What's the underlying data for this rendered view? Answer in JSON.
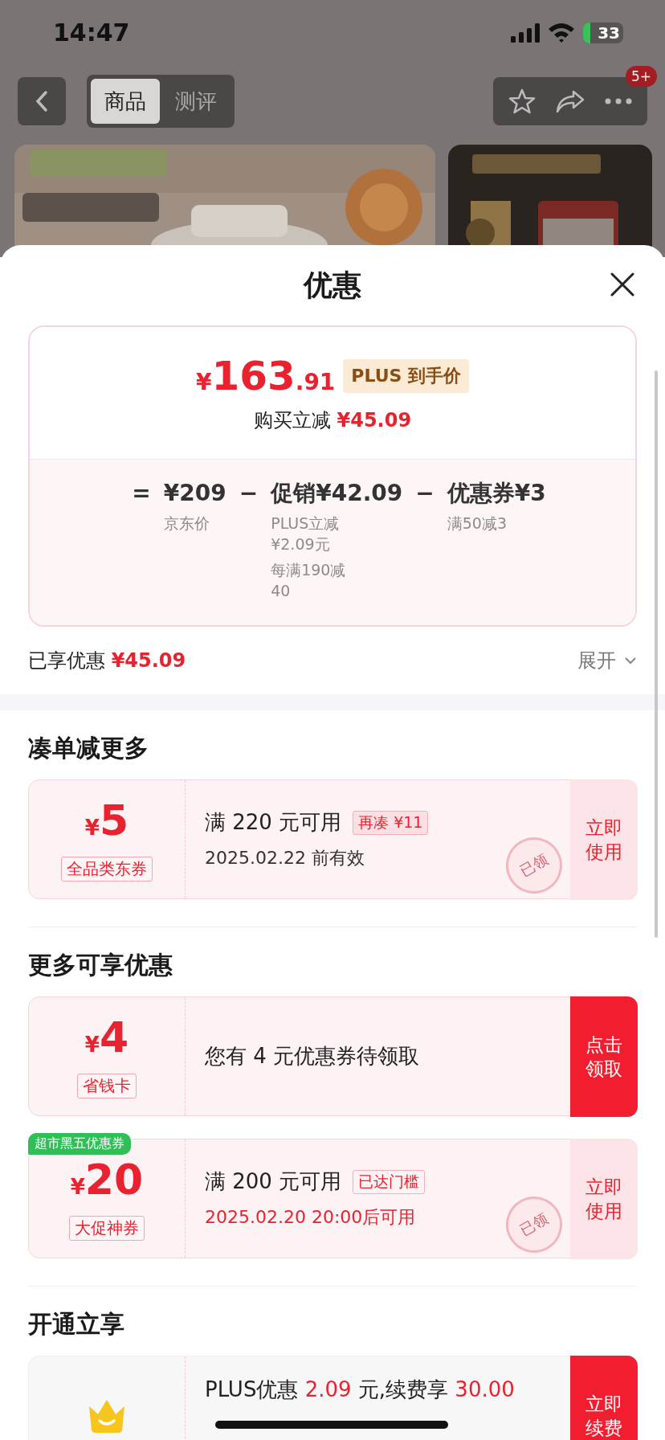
{
  "status_bar": {
    "time": "14:47",
    "battery": "33"
  },
  "nav": {
    "tabs": [
      {
        "label": "商品",
        "selected": true
      },
      {
        "label": "测评",
        "selected": false
      }
    ],
    "badge": "5+"
  },
  "sheet": {
    "title": "优惠",
    "price_card": {
      "currency": "¥",
      "price_int": "163",
      "price_dec": ".91",
      "price_tag": "PLUS 到手价",
      "saving_label": "购买立减",
      "saving": "¥45.09",
      "breakdown": [
        {
          "op": "=",
          "amount": "¥209",
          "notes": [
            "京东价"
          ]
        },
        {
          "op": "−",
          "amount": "促销¥42.09",
          "notes": [
            "PLUS立减 ¥2.09元",
            "每满190减40"
          ]
        },
        {
          "op": "−",
          "amount": "优惠券¥3",
          "notes": [
            "满50减3"
          ]
        }
      ]
    },
    "enjoyed": {
      "label": "已享优惠",
      "amount": "¥45.09"
    },
    "expand": "展开",
    "sections": [
      {
        "title": "凑单减更多",
        "coupons": [
          {
            "left": {
              "kind": "amount",
              "currency": "¥",
              "amount": "5",
              "type_label": "全品类东券"
            },
            "body": {
              "kind": "terms",
              "condition": "满 220 元可用",
              "tag": "再凑 ¥11",
              "tag_filled": true,
              "validity": "2025.02.22 前有效",
              "validity_highlight": false
            },
            "stamp": "已领",
            "action": {
              "kind": "use",
              "label": "立即使用"
            }
          }
        ]
      },
      {
        "title": "更多可享优惠",
        "coupons": [
          {
            "left": {
              "kind": "amount",
              "currency": "¥",
              "amount": "4",
              "type_label": "省钱卡"
            },
            "body": {
              "kind": "text",
              "parts": [
                {
                  "text": "您有 4 元优惠券待领取",
                  "highlight": false
                }
              ]
            },
            "action": {
              "kind": "claim",
              "label": "点击领取"
            }
          },
          {
            "corner_tag": "超市黑五优惠券",
            "left": {
              "kind": "amount",
              "currency": "¥",
              "amount": "20",
              "type_label": "大促神券"
            },
            "body": {
              "kind": "terms",
              "condition": "满 200 元可用",
              "tag": "已达门槛",
              "tag_filled": false,
              "validity": "2025.02.20 20:00后可用",
              "validity_highlight": true
            },
            "stamp": "已领",
            "action": {
              "kind": "use",
              "label": "立即使用"
            }
          }
        ]
      },
      {
        "title": "开通立享",
        "coupons": [
          {
            "left": {
              "kind": "crown"
            },
            "body": {
              "kind": "text",
              "parts": [
                {
                  "text": "PLUS优惠 ",
                  "highlight": false
                },
                {
                  "text": "2.09",
                  "highlight": true
                },
                {
                  "text": " 元,续费享 ",
                  "highlight": false
                },
                {
                  "text": "30.00",
                  "highlight": true
                }
              ]
            },
            "action": {
              "kind": "claim",
              "label": "立即续费"
            }
          }
        ]
      }
    ]
  }
}
